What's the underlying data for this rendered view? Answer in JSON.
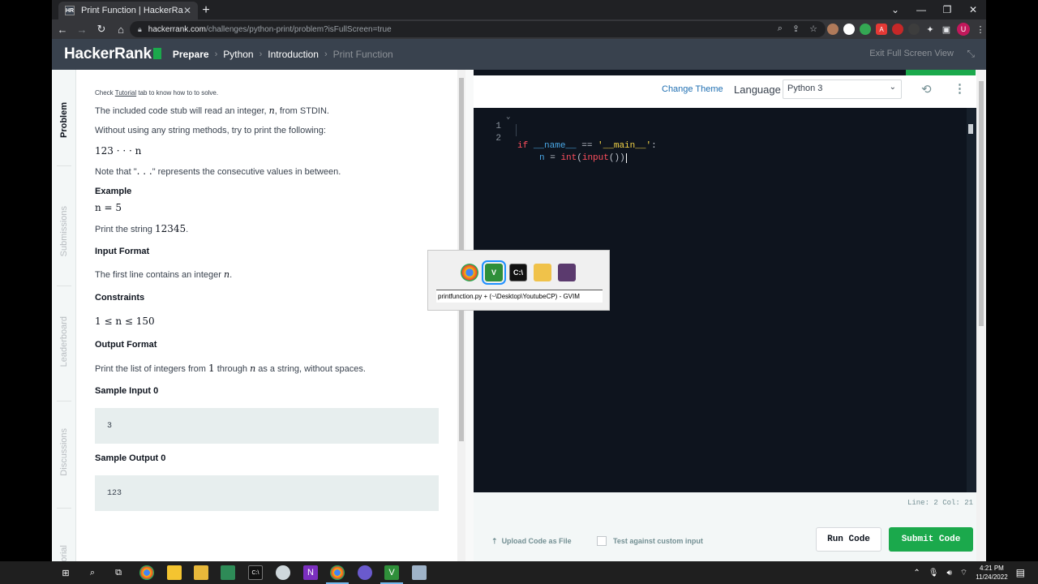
{
  "browser": {
    "tab_title": "Print Function | HackerRank",
    "tab_close": "✕",
    "new_tab": "+",
    "url_host": "hackerrank.com",
    "url_path": "/challenges/python-print/problem?isFullScreen=true",
    "profile_initial": "U"
  },
  "header": {
    "logo": "HackerRank",
    "breadcrumb": [
      "Prepare",
      "Python",
      "Introduction",
      "Print Function"
    ],
    "exit_fullscreen": "Exit Full Screen View"
  },
  "side_tabs": [
    "Problem",
    "Submissions",
    "Leaderboard",
    "Discussions",
    "Tutorial"
  ],
  "problem": {
    "check_pre": "Check ",
    "check_link": "Tutorial",
    "check_post": " tab to know how to to solve.",
    "stub_pre": "The included code stub will read an integer, ",
    "stub_var": "n",
    "stub_post": ", from STDIN.",
    "without": "Without using any string methods, try to print the following:",
    "sequence": "123 · · · n",
    "note_pre": "Note that \"",
    "note_dots": ". . .",
    "note_post": "\" represents the consecutive values in between.",
    "example_heading": "Example",
    "example_n": "n = 5",
    "print_pre": "Print the string ",
    "print_val": "12345",
    "print_post": ".",
    "input_format_heading": "Input Format",
    "input_format_pre": "The first line contains an integer ",
    "input_format_var": "n",
    "input_format_post": ".",
    "constraints_heading": "Constraints",
    "constraint": "1 ≤ n ≤ 150",
    "output_format_heading": "Output Format",
    "output_pre": "Print the list of integers from ",
    "output_one": "1",
    "output_mid": " through ",
    "output_var": "n",
    "output_post": " as a string, without spaces.",
    "sample_input_heading": "Sample Input 0",
    "sample_input": "3",
    "sample_output_heading": "Sample Output 0",
    "sample_output": "123"
  },
  "editor": {
    "change_theme": "Change Theme",
    "language_label": "Language",
    "language_value": "Python 3",
    "line_numbers": [
      "1",
      "2"
    ],
    "line1": {
      "kw": "if",
      "name": "__name__",
      "op": "==",
      "str": "'__main__'",
      "colon": ":"
    },
    "line2": {
      "var": "n",
      "eq": "=",
      "fn1": "int",
      "p1": "(",
      "fn2": "input",
      "p2": "())"
    },
    "status": "Line: 2 Col: 21",
    "upload": "Upload Code as File",
    "test_custom": "Test against custom input",
    "run": "Run Code",
    "submit": "Submit Code"
  },
  "switcher": {
    "selected_title": "printfunction.py + (~\\Desktop\\YoutubeCP) - GVIM"
  },
  "taskbar": {
    "time": "4:21 PM",
    "date": "11/24/2022"
  },
  "colors": {
    "accent_green": "#1ba94c",
    "header_bg": "#39424e",
    "editor_bg": "#0e141e"
  }
}
